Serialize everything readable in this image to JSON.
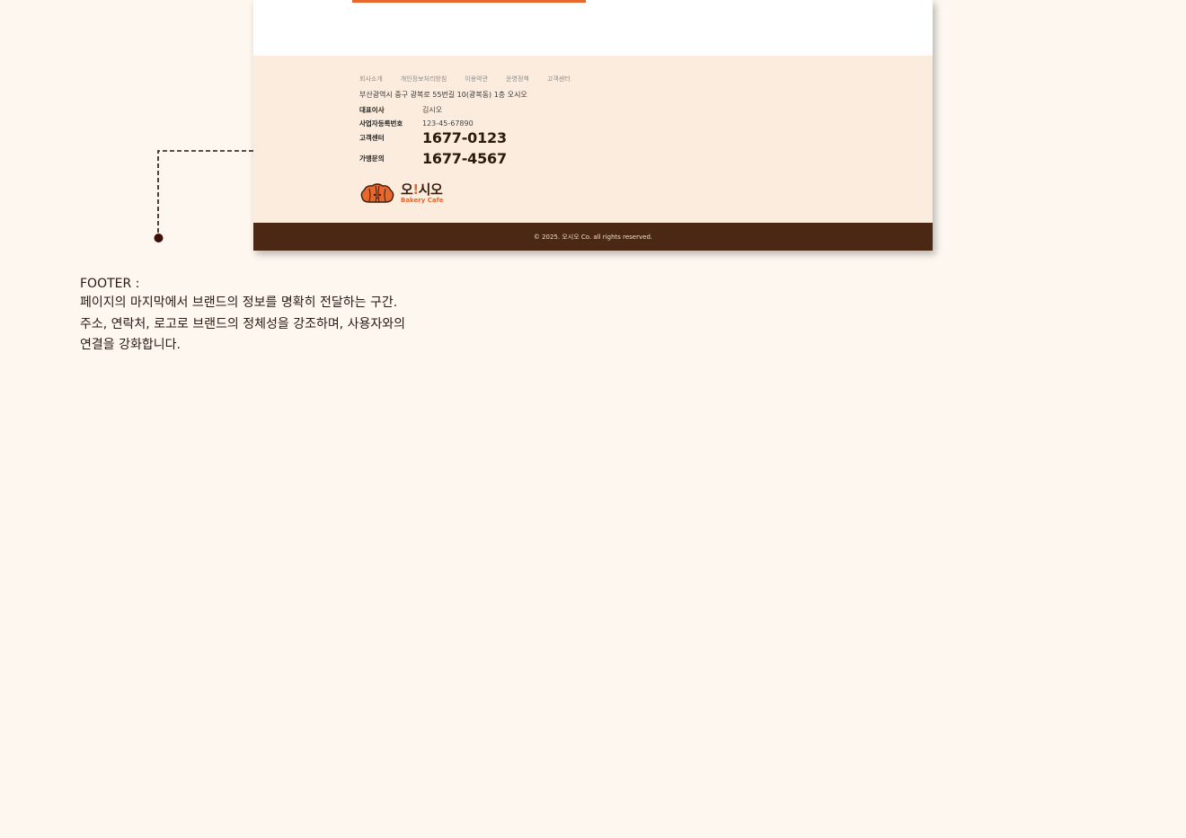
{
  "footer": {
    "links": [
      "회사소개",
      "개인정보처리방침",
      "이용약관",
      "운영정책",
      "고객센터"
    ],
    "address": "부산광역시 중구 광복로 55번길 10(광복동) 1층 오시오",
    "ceo": {
      "label": "대표이사",
      "value": "김시오"
    },
    "business_number": {
      "label": "사업자등록번호",
      "value": "123-45-67890"
    },
    "customer_center": {
      "label": "고객센터",
      "value": "1677-0123"
    },
    "franchise": {
      "label": "가맹문의",
      "value": "1677-4567"
    },
    "logo": {
      "name_part1": "오",
      "name_mark": "!",
      "name_part2": "시오",
      "subtitle": "Bakery Cafe"
    },
    "copyright": "© 2025. 오시오 Co. all rights reserved."
  },
  "annotation": {
    "title": "FOOTER :",
    "lines": [
      "페이지의 마지막에서 브랜드의 정보를 명확히 전달하는 구간.",
      "주소, 연락처, 로고로 브랜드의 정체성을 강조하며, 사용자와의",
      "연결을 강화합니다."
    ]
  },
  "colors": {
    "page_bg": "#fdf7f0",
    "accent": "#e8672c",
    "footer_bg": "#fcecdd",
    "copyright_bg": "#4a2813",
    "brand_brown": "#3a1e0d"
  }
}
